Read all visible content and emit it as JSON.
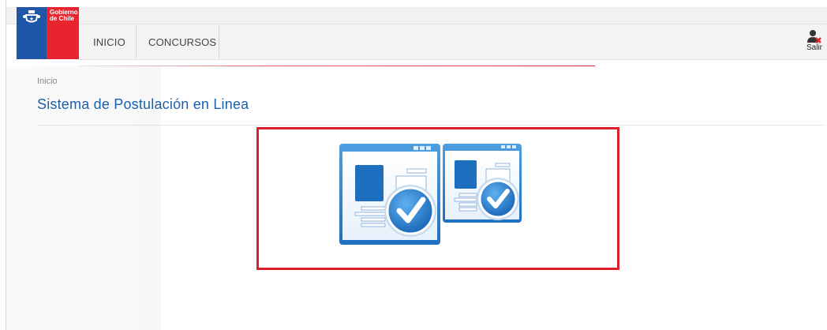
{
  "brand": {
    "line1": "Gobierno",
    "line2": "de Chile"
  },
  "nav": {
    "items": [
      {
        "label": "INICIO"
      },
      {
        "label": "CONCURSOS"
      }
    ]
  },
  "user": {
    "logout_label": "Salir"
  },
  "breadcrumb": {
    "label": "Inicio"
  },
  "page": {
    "title": "Sistema de Postulación en Linea"
  },
  "colors": {
    "brand_blue": "#1f56a8",
    "brand_red": "#e8252f",
    "title_blue": "#1d62a8",
    "highlight_red": "#dc1f2b"
  }
}
